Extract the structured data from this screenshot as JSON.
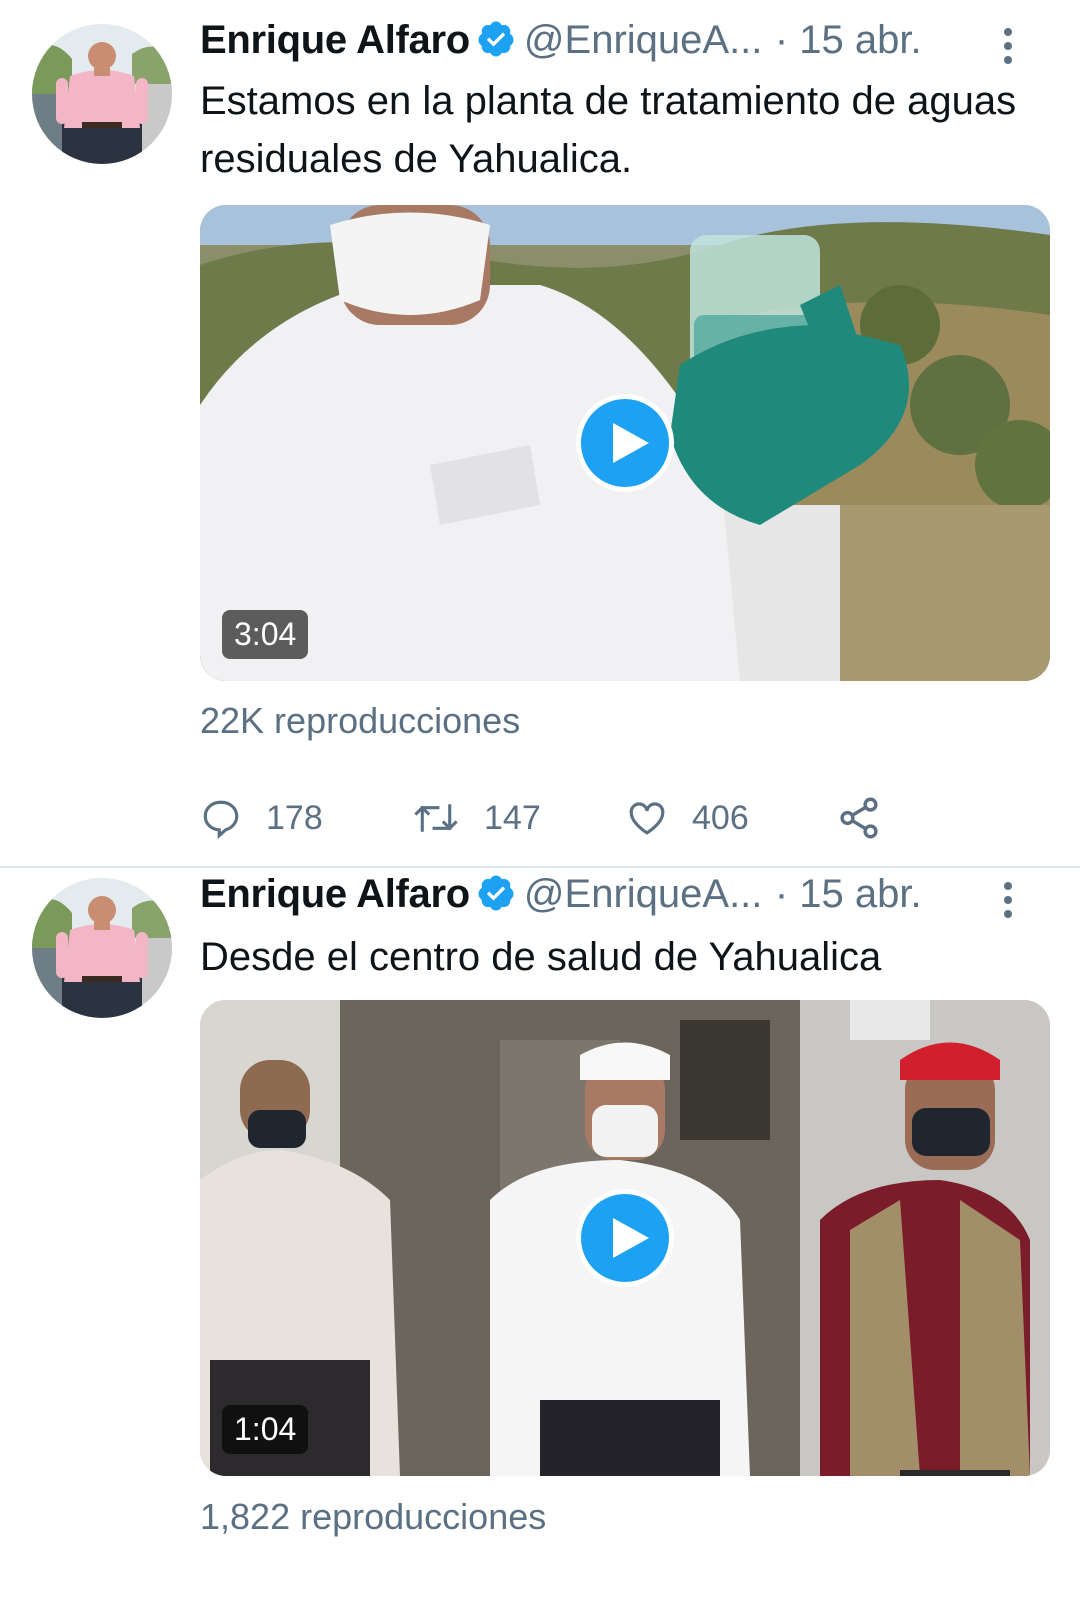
{
  "colors": {
    "accent": "#1da1f2",
    "secondary_text": "#5b7083",
    "divider": "#e1e8ed"
  },
  "tweets": [
    {
      "author_name": "Enrique Alfaro",
      "handle": "@EnriqueA...",
      "date": "· 15 abr.",
      "text": "Estamos en la planta de tratamiento de aguas residuales de Yahualica.",
      "video_duration": "3:04",
      "views": "22K reproducciones",
      "replies": "178",
      "retweets": "147",
      "likes": "406",
      "icons": [
        "verified-badge-icon",
        "more-vertical-icon",
        "play-icon",
        "reply-icon",
        "retweet-icon",
        "like-icon",
        "share-icon"
      ]
    },
    {
      "author_name": "Enrique Alfaro",
      "handle": "@EnriqueA...",
      "date": "· 15 abr.",
      "text": "Desde el centro de salud de Yahualica",
      "video_duration": "1:04",
      "views": "1,822 reproducciones",
      "icons": [
        "verified-badge-icon",
        "more-vertical-icon",
        "play-icon"
      ]
    }
  ]
}
